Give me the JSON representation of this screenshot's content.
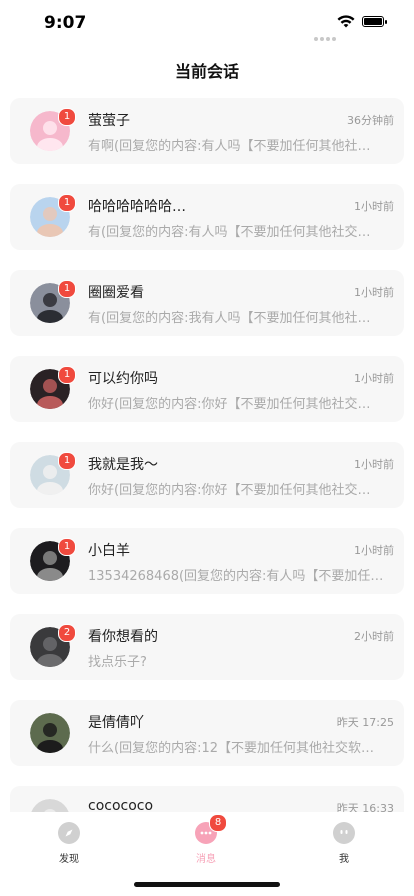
{
  "status_bar": {
    "time": "9:07"
  },
  "header": {
    "title": "当前会话"
  },
  "conversations": [
    {
      "name": "萤萤子",
      "time": "36分钟前",
      "preview": "有啊(回复您的内容:有人吗【不要加任何其他社…",
      "badge": "1",
      "avatar_color": "#f6b8cc",
      "avatar_accent": "#ffe6ef"
    },
    {
      "name": "哈哈哈哈哈哈…",
      "time": "1小时前",
      "preview": "有(回复您的内容:有人吗【不要加任何其他社交…",
      "badge": "1",
      "avatar_color": "#b9d4ee",
      "avatar_accent": "#e9c7b5"
    },
    {
      "name": "圈圈爱看",
      "time": "1小时前",
      "preview": "有(回复您的内容:我有人吗【不要加任何其他社…",
      "badge": "1",
      "avatar_color": "#8a8f9c",
      "avatar_accent": "#2b2d33"
    },
    {
      "name": "可以约你吗",
      "time": "1小时前",
      "preview": "你好(回复您的内容:你好【不要加任何其他社交…",
      "badge": "1",
      "avatar_color": "#2a2225",
      "avatar_accent": "#b85a5a"
    },
    {
      "name": "我就是我～",
      "time": "1小时前",
      "preview": "你好(回复您的内容:你好【不要加任何其他社交…",
      "badge": "1",
      "avatar_color": "#cfdce3",
      "avatar_accent": "#f0f0f0"
    },
    {
      "name": "小白羊",
      "time": "1小时前",
      "preview": "13534268468(回复您的内容:有人吗【不要加任…",
      "badge": "1",
      "avatar_color": "#1d1c1f",
      "avatar_accent": "#8a8a8a"
    },
    {
      "name": "看你想看的",
      "time": "2小时前",
      "preview": "找点乐子?",
      "badge": "2",
      "avatar_color": "#3a3a3c",
      "avatar_accent": "#6b6b6d"
    },
    {
      "name": "是倩倩吖",
      "time": "昨天 17:25",
      "preview": "什么(回复您的内容:12【不要加任何其他社交软…",
      "badge": "",
      "avatar_color": "#5d6b4e",
      "avatar_accent": "#1c1c1c"
    },
    {
      "name": "cocococo",
      "time": "昨天 16:33",
      "preview": "",
      "badge": "",
      "avatar_color": "#d8d8d8",
      "avatar_accent": "#eeeeee"
    }
  ],
  "tab_bar": {
    "tabs": [
      {
        "label": "发现",
        "icon": "compass-icon",
        "color": "#d0d0d0",
        "label_color": "#333333"
      },
      {
        "label": "消息",
        "icon": "chat-icon",
        "color": "#f7a3b8",
        "label_color": "#f7a3b8",
        "badge": "8"
      },
      {
        "label": "我",
        "icon": "profile-face-icon",
        "color": "#d0d0d0",
        "label_color": "#333333"
      }
    ]
  },
  "colors": {
    "accent": "#f7a3b8",
    "badge": "#f04a3e",
    "card_bg": "#f7f7f7"
  }
}
